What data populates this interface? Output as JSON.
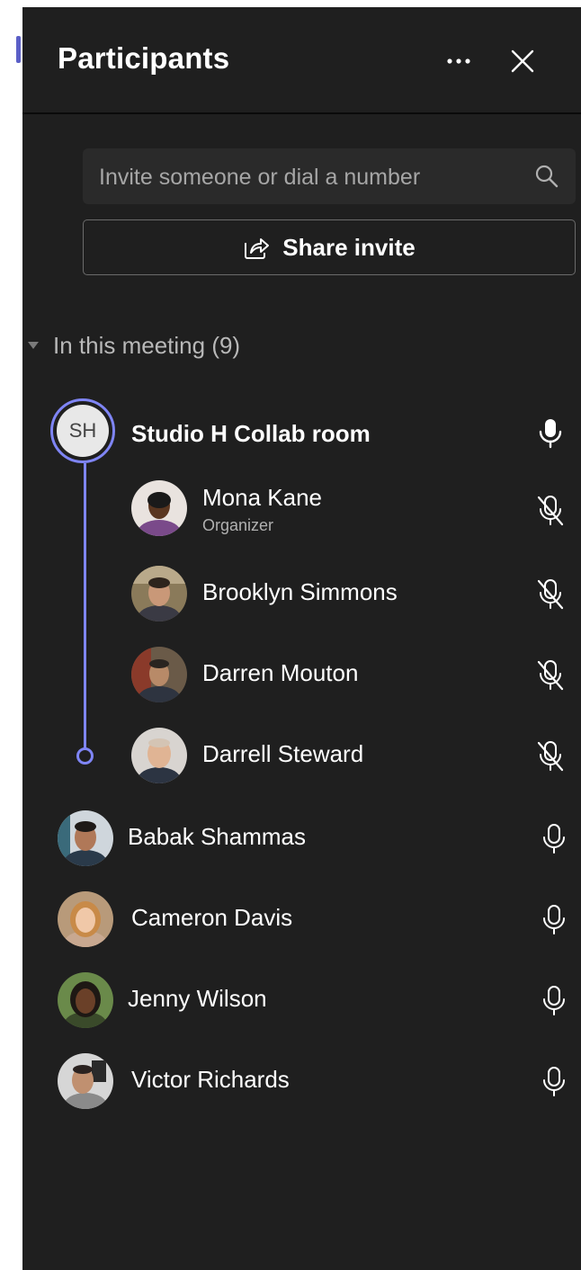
{
  "header": {
    "title": "Participants",
    "more_icon": "more-horizontal-icon",
    "close_icon": "close-icon"
  },
  "search": {
    "placeholder": "Invite someone or dial a number",
    "icon": "search-icon"
  },
  "share": {
    "label": "Share invite",
    "icon": "share-icon"
  },
  "section": {
    "label": "In this meeting (9)"
  },
  "room": {
    "initials": "SH",
    "name": "Studio H Collab room",
    "mic": "mic-on"
  },
  "room_members": [
    {
      "name": "Mona Kane",
      "role": "Organizer",
      "mic": "mic-off"
    },
    {
      "name": "Brooklyn Simmons",
      "mic": "mic-off"
    },
    {
      "name": "Darren Mouton",
      "mic": "mic-off"
    },
    {
      "name": "Darrell Steward",
      "mic": "mic-off"
    }
  ],
  "participants": [
    {
      "name": "Babak Shammas",
      "mic": "mic-on"
    },
    {
      "name": "Cameron Davis",
      "mic": "mic-on"
    },
    {
      "name": "Jenny Wilson",
      "mic": "mic-on"
    },
    {
      "name": "Victor Richards",
      "mic": "mic-on"
    }
  ],
  "colors": {
    "panel_bg": "#1f1f1f",
    "accent": "#7f85f5",
    "text": "#ffffff",
    "muted_text": "#b8b8b8"
  }
}
